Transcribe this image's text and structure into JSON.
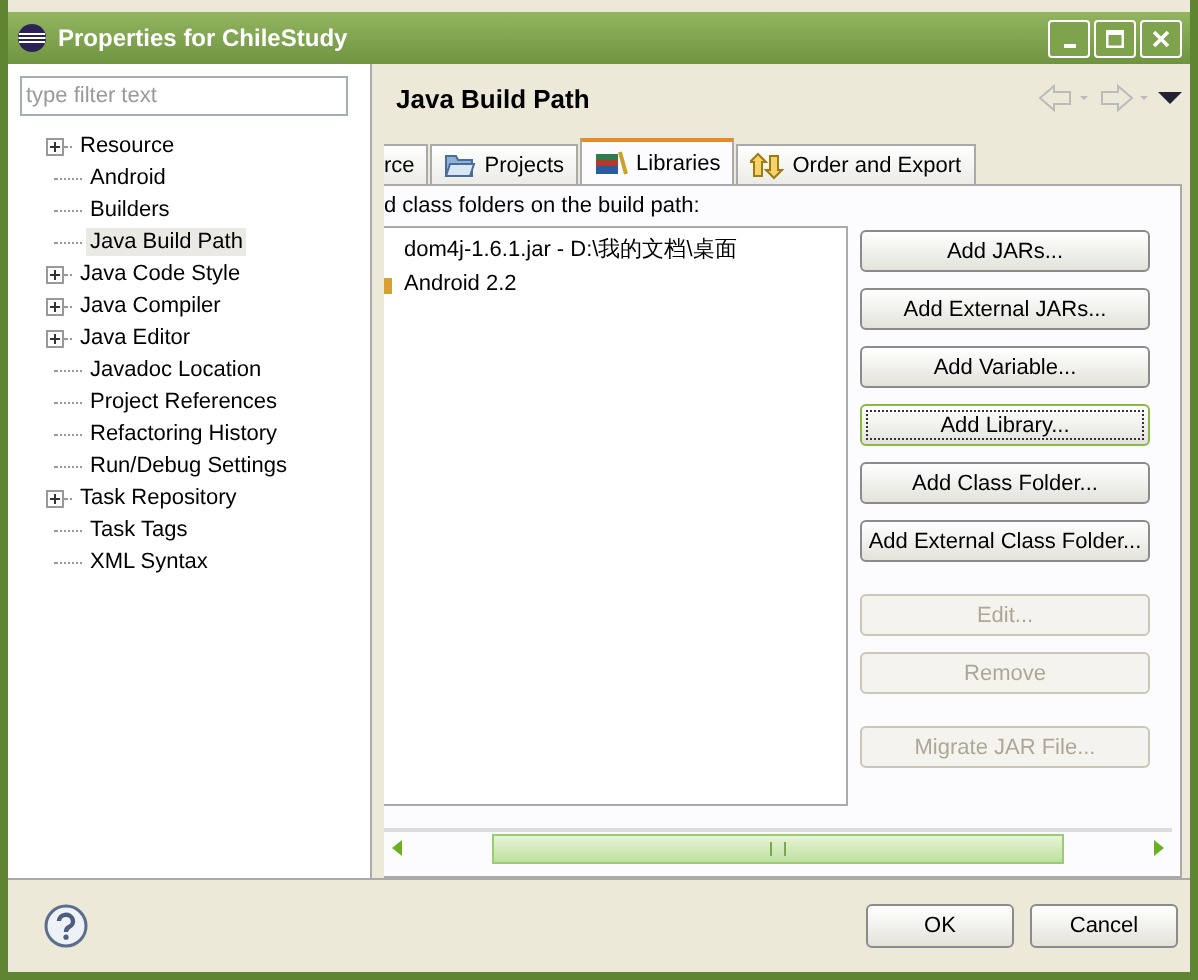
{
  "window": {
    "title": "Properties for ChileStudy"
  },
  "filter": {
    "placeholder": "type filter text"
  },
  "tree": [
    {
      "label": "Resource",
      "kind": "group",
      "selected": false
    },
    {
      "label": "Android",
      "kind": "page",
      "selected": false
    },
    {
      "label": "Builders",
      "kind": "page",
      "selected": false
    },
    {
      "label": "Java Build Path",
      "kind": "page",
      "selected": true
    },
    {
      "label": "Java Code Style",
      "kind": "group",
      "selected": false
    },
    {
      "label": "Java Compiler",
      "kind": "group",
      "selected": false
    },
    {
      "label": "Java Editor",
      "kind": "group",
      "selected": false
    },
    {
      "label": "Javadoc Location",
      "kind": "page",
      "selected": false
    },
    {
      "label": "Project References",
      "kind": "page",
      "selected": false
    },
    {
      "label": "Refactoring History",
      "kind": "page",
      "selected": false
    },
    {
      "label": "Run/Debug Settings",
      "kind": "page",
      "selected": false
    },
    {
      "label": "Task Repository",
      "kind": "group",
      "selected": false
    },
    {
      "label": "Task Tags",
      "kind": "page",
      "selected": false
    },
    {
      "label": "XML Syntax",
      "kind": "page",
      "selected": false
    }
  ],
  "page": {
    "title": "Java Build Path"
  },
  "tabs": [
    {
      "label": "rce",
      "kind": "cut",
      "selected": false
    },
    {
      "label": "Projects",
      "kind": "projects",
      "selected": false
    },
    {
      "label": "Libraries",
      "kind": "libraries",
      "selected": true
    },
    {
      "label": "Order and Export",
      "kind": "order",
      "selected": false
    }
  ],
  "caption": "d class folders on the build path:",
  "entries": [
    {
      "label": "dom4j-1.6.1.jar - D:\\我的文档\\桌面",
      "kind": "jar"
    },
    {
      "label": "Android 2.2",
      "kind": "container"
    }
  ],
  "button_groups": [
    [
      {
        "label": "Add JARs...",
        "disabled": false,
        "focused": false
      },
      {
        "label": "Add External JARs...",
        "disabled": false,
        "focused": false
      },
      {
        "label": "Add Variable...",
        "disabled": false,
        "focused": false
      },
      {
        "label": "Add Library...",
        "disabled": false,
        "focused": true
      },
      {
        "label": "Add Class Folder...",
        "disabled": false,
        "focused": false
      },
      {
        "label": "Add External Class Folder...",
        "disabled": false,
        "focused": false
      }
    ],
    [
      {
        "label": "Edit...",
        "disabled": true,
        "focused": false
      },
      {
        "label": "Remove",
        "disabled": true,
        "focused": false
      }
    ],
    [
      {
        "label": "Migrate JAR File...",
        "disabled": true,
        "focused": false
      }
    ]
  ],
  "footer": {
    "ok": "OK",
    "cancel": "Cancel"
  }
}
